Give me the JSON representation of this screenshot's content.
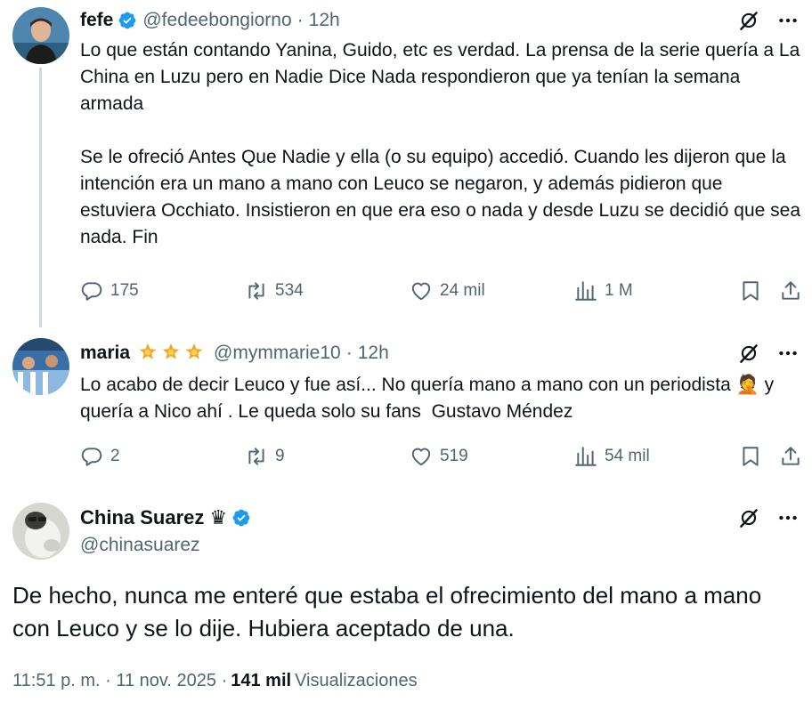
{
  "tweets": [
    {
      "name": "fefe",
      "handle": "@fedeebongiorno",
      "time": "12h",
      "text": "Lo que están contando Yanina, Guido, etc es verdad. La prensa de la serie quería a La China en Luzu pero en Nadie Dice Nada respondieron que ya tenían la semana armada\n\nSe le ofreció Antes Que Nadie y ella (o su equipo) accedió. Cuando les dijeron que la intención era un mano a mano con Leuco se negaron, y además pidieron que estuviera Occhiato. Insistieron en que era eso o nada y desde Luzu se decidió que sea nada. Fin",
      "replies": "175",
      "reposts": "534",
      "likes": "24 mil",
      "views": "1 M"
    },
    {
      "name": "maria",
      "handle": "@mymmarie10",
      "time": "12h",
      "text": "Lo acabo de decir Leuco y fue así... No quería mano a mano con un periodista 🤦 y quería a Nico ahí . Le queda solo su fans  Gustavo Méndez",
      "replies": "2",
      "reposts": "9",
      "likes": "519",
      "views": "54 mil"
    }
  ],
  "main_tweet": {
    "name": "China Suarez",
    "crown": "♛",
    "handle": "@chinasuarez",
    "text": "De hecho, nunca me enteré que estaba el ofrecimiento del mano a mano con Leuco y se lo dije. Hubiera aceptado de una.",
    "timestamp": "11:51 p. m. · 11 nov. 2025 ·",
    "views_count": "141 mil",
    "views_label": "Visualizaciones"
  },
  "colors": {
    "verified": "#1d9bf0",
    "secondary_text": "#536471",
    "star": "#f5a623"
  },
  "icons": [
    "verified-badge-icon",
    "grok-icon",
    "more-icon",
    "reply-icon",
    "repost-icon",
    "like-icon",
    "views-icon",
    "bookmark-icon",
    "share-icon",
    "star-icon"
  ]
}
